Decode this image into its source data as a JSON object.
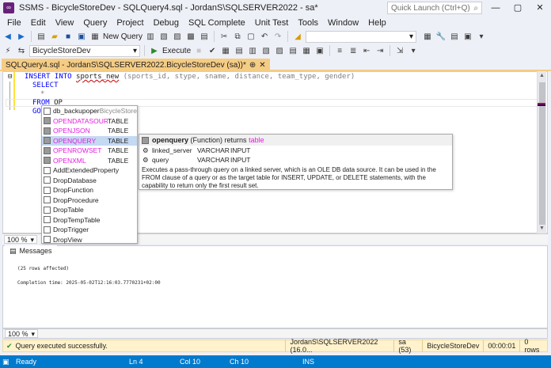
{
  "window": {
    "app_short": "SSMS",
    "title": "SSMS - BicycleStoreDev - SQLQuery4.sql - JordanS\\SQLSERVER2022 - sa*",
    "quick_launch": "Quick Launch (Ctrl+Q)",
    "minimize": "—",
    "maximize": "▢",
    "close": "✕"
  },
  "menu": [
    "File",
    "Edit",
    "View",
    "Query",
    "Project",
    "Debug",
    "SQL Complete",
    "Unit Test",
    "Tools",
    "Window",
    "Help"
  ],
  "toolbar1": {
    "new_query": "New Query"
  },
  "toolbar2": {
    "database": "BicycleStoreDev",
    "execute": "Execute"
  },
  "tab": {
    "label": "SQLQuery4.sql - JordanS\\SQLSERVER2022.BicycleStoreDev (sa))*",
    "pin": "⊕",
    "close": "✕"
  },
  "editor": {
    "line1": {
      "kw1": "INSERT INTO",
      "table": "sports_new",
      "cols": "(sports_id, stype, sname, distance, team_type, gender)"
    },
    "line2": "SELECT",
    "line3": "*",
    "line5": {
      "kw": "FROM",
      "typed": "OP"
    },
    "line6": "GO"
  },
  "autocomplete": [
    {
      "name": "db_backupoperator",
      "type": "BicycleStore",
      "pink": false,
      "selected": false
    },
    {
      "name": "OPENDATASOUR...",
      "type": "TABLE",
      "pink": true,
      "selected": false
    },
    {
      "name": "OPENJSON",
      "type": "TABLE",
      "pink": true,
      "selected": false
    },
    {
      "name": "OPENQUERY",
      "type": "TABLE",
      "pink": true,
      "selected": true
    },
    {
      "name": "OPENROWSET",
      "type": "TABLE",
      "pink": true,
      "selected": false
    },
    {
      "name": "OPENXML",
      "type": "TABLE",
      "pink": true,
      "selected": false
    },
    {
      "name": "AddExtendedProperty",
      "type": "",
      "pink": false,
      "selected": false
    },
    {
      "name": "DropDatabase",
      "type": "",
      "pink": false,
      "selected": false
    },
    {
      "name": "DropFunction",
      "type": "",
      "pink": false,
      "selected": false
    },
    {
      "name": "DropProcedure",
      "type": "",
      "pink": false,
      "selected": false
    },
    {
      "name": "DropTable",
      "type": "",
      "pink": false,
      "selected": false
    },
    {
      "name": "DropTempTable",
      "type": "",
      "pink": false,
      "selected": false
    },
    {
      "name": "DropTrigger",
      "type": "",
      "pink": false,
      "selected": false
    },
    {
      "name": "DropView",
      "type": "",
      "pink": false,
      "selected": false
    }
  ],
  "tooltip": {
    "name": "openquery",
    "kind": "(Function) returns",
    "returns": "table",
    "params": [
      {
        "name": "linked_server",
        "type": "VARCHAR",
        "dir": "INPUT"
      },
      {
        "name": "query",
        "type": "VARCHAR",
        "dir": "INPUT"
      }
    ],
    "description": "Executes a pass-through query on a linked server, which is an OLE DB data source. It can be used in the FROM clause of a query or as the target table for INSERT, UPDATE, or DELETE statements, with the capability to return only the first result set."
  },
  "zoom_top": "100 %",
  "messages": {
    "tab_label": "Messages",
    "line1": "(25 rows affected)",
    "line2": "Completion time: 2025-05-02T12:16:03.7770231+02:00"
  },
  "zoom_bottom": "100 %",
  "query_status": {
    "message": "Query executed successfully.",
    "server": "JordanS\\SQLSERVER2022 (16.0...",
    "login": "sa (53)",
    "database": "BicycleStoreDev",
    "elapsed": "00:00:01",
    "rows": "0 rows"
  },
  "statusbar": {
    "ready": "Ready",
    "line": "Ln 4",
    "col": "Col 10",
    "ch": "Ch 10",
    "mode": "INS"
  },
  "colors": {
    "accent_blue": "#007acc",
    "tab_yellow": "#f5cc84",
    "keyword_blue": "#0000ff",
    "function_pink": "#e31cdf",
    "selection": "#c4d9f2"
  }
}
